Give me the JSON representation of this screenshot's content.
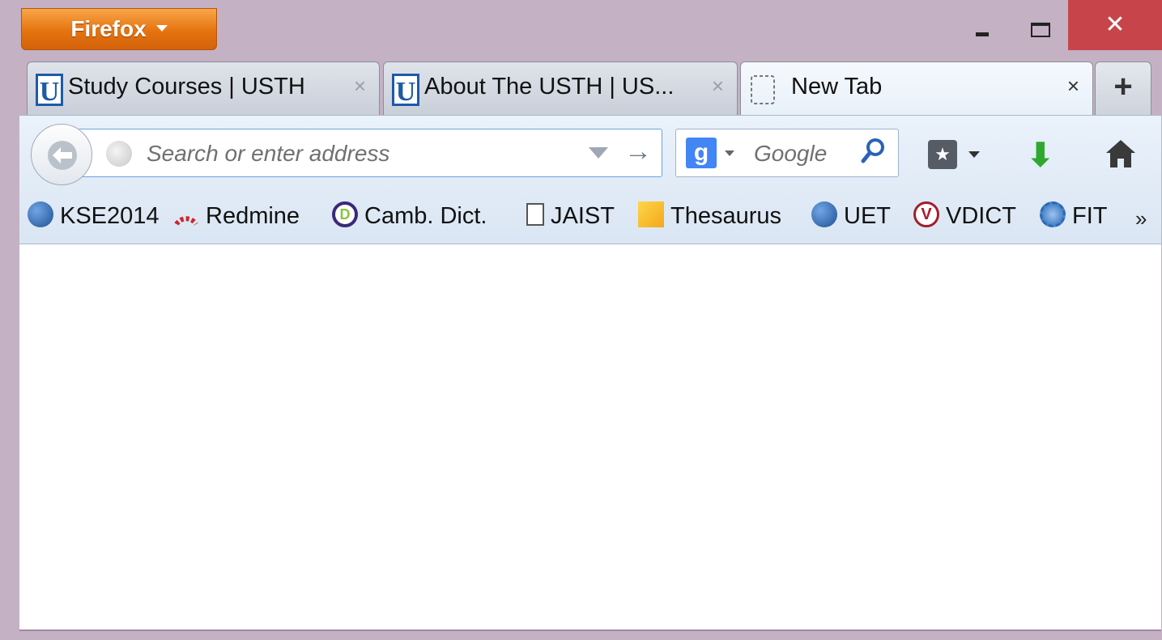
{
  "window": {
    "app_button_label": "Firefox",
    "minimize_glyph": "_",
    "maximize_glyph": "□",
    "close_glyph": "✕"
  },
  "tabs": [
    {
      "title": "Study Courses | USTH",
      "favicon": "usth-favicon",
      "active": false
    },
    {
      "title": "About The USTH | US...",
      "favicon": "usth-favicon",
      "active": false
    },
    {
      "title": "New Tab",
      "favicon": "blank-page-icon",
      "active": true
    }
  ],
  "tab_close_glyph": "×",
  "new_tab_glyph": "+",
  "navigation": {
    "back_glyph": "←",
    "url_placeholder": "Search or enter address",
    "go_glyph": "→"
  },
  "search": {
    "engine_glyph": "g",
    "placeholder": "Google",
    "search_glyph": "⚲"
  },
  "toolbar_icons": {
    "bookmarks_menu_glyph": "★",
    "downloads_glyph": "⬇",
    "home_glyph": "⌂"
  },
  "bookmarks": [
    {
      "label": "KSE2014",
      "icon": "blue-ball-icon"
    },
    {
      "label": "Redmine",
      "icon": "redmine-icon"
    },
    {
      "label": "Camb. Dict.",
      "icon": "cambridge-icon"
    },
    {
      "label": "JAIST",
      "icon": "document-icon"
    },
    {
      "label": "Thesaurus",
      "icon": "thesaurus-icon"
    },
    {
      "label": "UET",
      "icon": "blue-ball-icon"
    },
    {
      "label": "VDICT",
      "icon": "vdict-icon"
    },
    {
      "label": "FIT",
      "icon": "fit-icon"
    }
  ],
  "bookmarks_overflow_glyph": "»",
  "colors": {
    "frame": "#c4b1c4",
    "firefox_button": "#e5730f",
    "close_button": "#c7454a",
    "toolbar": "#dae6f3"
  }
}
